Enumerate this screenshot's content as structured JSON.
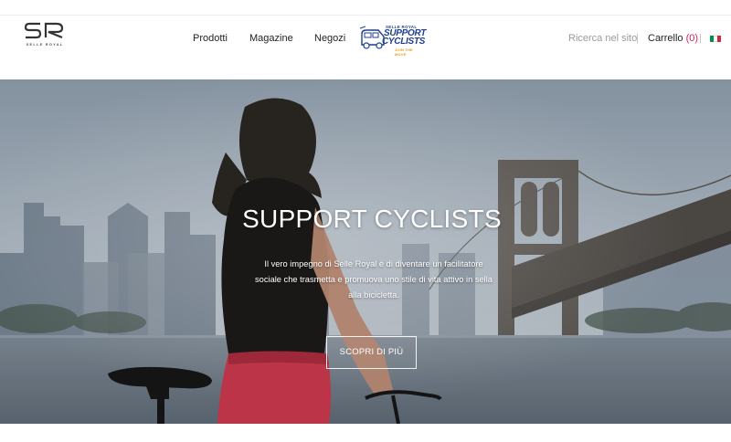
{
  "brand": {
    "logo_text": "SR",
    "logo_subtext": "SELLE ROYAL"
  },
  "nav": {
    "items": [
      {
        "label": "Prodotti"
      },
      {
        "label": "Magazine"
      },
      {
        "label": "Negozi"
      }
    ]
  },
  "badge": {
    "small": "SELLE ROYAL",
    "line1": "SUPPORT",
    "line2": "CYCLISTS",
    "tag": "JOIN THE MOVE"
  },
  "utility": {
    "search_label": "Ricerca nel sito",
    "separator": "|",
    "cart_label": "Carrello",
    "cart_count": "(0)",
    "language_flag": "italian-flag",
    "flag_colors": [
      "#009246",
      "#ffffff",
      "#ce2b37"
    ]
  },
  "hero": {
    "title": "SUPPORT CYCLISTS",
    "body": "Il vero impegno di Selle Royal è di diventare un facilitatore sociale che trasmetta e promuova uno stile di vita attivo in sella alla bicicletta.",
    "cta_label": "SCOPRI DI PIÙ"
  },
  "colors": {
    "accent": "#d0205a",
    "badge_blue": "#1f3f8f",
    "badge_orange": "#e8a014"
  }
}
